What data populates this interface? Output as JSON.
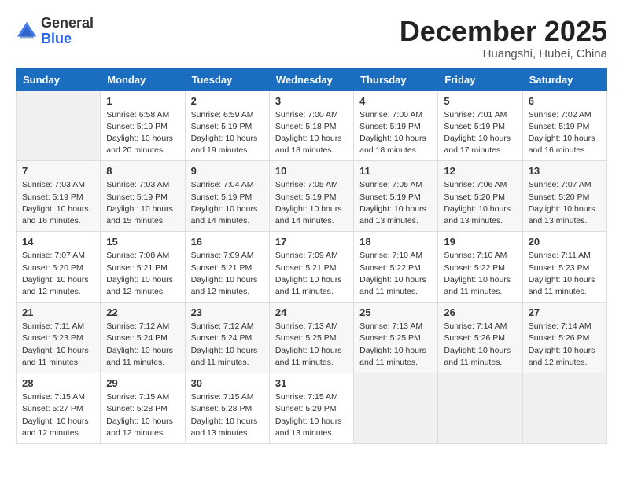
{
  "header": {
    "logo": {
      "line1": "General",
      "line2": "Blue"
    },
    "title": "December 2025",
    "subtitle": "Huangshi, Hubei, China"
  },
  "weekdays": [
    "Sunday",
    "Monday",
    "Tuesday",
    "Wednesday",
    "Thursday",
    "Friday",
    "Saturday"
  ],
  "weeks": [
    [
      {
        "day": "",
        "info": ""
      },
      {
        "day": "1",
        "info": "Sunrise: 6:58 AM\nSunset: 5:19 PM\nDaylight: 10 hours\nand 20 minutes."
      },
      {
        "day": "2",
        "info": "Sunrise: 6:59 AM\nSunset: 5:19 PM\nDaylight: 10 hours\nand 19 minutes."
      },
      {
        "day": "3",
        "info": "Sunrise: 7:00 AM\nSunset: 5:18 PM\nDaylight: 10 hours\nand 18 minutes."
      },
      {
        "day": "4",
        "info": "Sunrise: 7:00 AM\nSunset: 5:19 PM\nDaylight: 10 hours\nand 18 minutes."
      },
      {
        "day": "5",
        "info": "Sunrise: 7:01 AM\nSunset: 5:19 PM\nDaylight: 10 hours\nand 17 minutes."
      },
      {
        "day": "6",
        "info": "Sunrise: 7:02 AM\nSunset: 5:19 PM\nDaylight: 10 hours\nand 16 minutes."
      }
    ],
    [
      {
        "day": "7",
        "info": "Sunrise: 7:03 AM\nSunset: 5:19 PM\nDaylight: 10 hours\nand 16 minutes."
      },
      {
        "day": "8",
        "info": "Sunrise: 7:03 AM\nSunset: 5:19 PM\nDaylight: 10 hours\nand 15 minutes."
      },
      {
        "day": "9",
        "info": "Sunrise: 7:04 AM\nSunset: 5:19 PM\nDaylight: 10 hours\nand 14 minutes."
      },
      {
        "day": "10",
        "info": "Sunrise: 7:05 AM\nSunset: 5:19 PM\nDaylight: 10 hours\nand 14 minutes."
      },
      {
        "day": "11",
        "info": "Sunrise: 7:05 AM\nSunset: 5:19 PM\nDaylight: 10 hours\nand 13 minutes."
      },
      {
        "day": "12",
        "info": "Sunrise: 7:06 AM\nSunset: 5:20 PM\nDaylight: 10 hours\nand 13 minutes."
      },
      {
        "day": "13",
        "info": "Sunrise: 7:07 AM\nSunset: 5:20 PM\nDaylight: 10 hours\nand 13 minutes."
      }
    ],
    [
      {
        "day": "14",
        "info": "Sunrise: 7:07 AM\nSunset: 5:20 PM\nDaylight: 10 hours\nand 12 minutes."
      },
      {
        "day": "15",
        "info": "Sunrise: 7:08 AM\nSunset: 5:21 PM\nDaylight: 10 hours\nand 12 minutes."
      },
      {
        "day": "16",
        "info": "Sunrise: 7:09 AM\nSunset: 5:21 PM\nDaylight: 10 hours\nand 12 minutes."
      },
      {
        "day": "17",
        "info": "Sunrise: 7:09 AM\nSunset: 5:21 PM\nDaylight: 10 hours\nand 11 minutes."
      },
      {
        "day": "18",
        "info": "Sunrise: 7:10 AM\nSunset: 5:22 PM\nDaylight: 10 hours\nand 11 minutes."
      },
      {
        "day": "19",
        "info": "Sunrise: 7:10 AM\nSunset: 5:22 PM\nDaylight: 10 hours\nand 11 minutes."
      },
      {
        "day": "20",
        "info": "Sunrise: 7:11 AM\nSunset: 5:23 PM\nDaylight: 10 hours\nand 11 minutes."
      }
    ],
    [
      {
        "day": "21",
        "info": "Sunrise: 7:11 AM\nSunset: 5:23 PM\nDaylight: 10 hours\nand 11 minutes."
      },
      {
        "day": "22",
        "info": "Sunrise: 7:12 AM\nSunset: 5:24 PM\nDaylight: 10 hours\nand 11 minutes."
      },
      {
        "day": "23",
        "info": "Sunrise: 7:12 AM\nSunset: 5:24 PM\nDaylight: 10 hours\nand 11 minutes."
      },
      {
        "day": "24",
        "info": "Sunrise: 7:13 AM\nSunset: 5:25 PM\nDaylight: 10 hours\nand 11 minutes."
      },
      {
        "day": "25",
        "info": "Sunrise: 7:13 AM\nSunset: 5:25 PM\nDaylight: 10 hours\nand 11 minutes."
      },
      {
        "day": "26",
        "info": "Sunrise: 7:14 AM\nSunset: 5:26 PM\nDaylight: 10 hours\nand 11 minutes."
      },
      {
        "day": "27",
        "info": "Sunrise: 7:14 AM\nSunset: 5:26 PM\nDaylight: 10 hours\nand 12 minutes."
      }
    ],
    [
      {
        "day": "28",
        "info": "Sunrise: 7:15 AM\nSunset: 5:27 PM\nDaylight: 10 hours\nand 12 minutes."
      },
      {
        "day": "29",
        "info": "Sunrise: 7:15 AM\nSunset: 5:28 PM\nDaylight: 10 hours\nand 12 minutes."
      },
      {
        "day": "30",
        "info": "Sunrise: 7:15 AM\nSunset: 5:28 PM\nDaylight: 10 hours\nand 13 minutes."
      },
      {
        "day": "31",
        "info": "Sunrise: 7:15 AM\nSunset: 5:29 PM\nDaylight: 10 hours\nand 13 minutes."
      },
      {
        "day": "",
        "info": ""
      },
      {
        "day": "",
        "info": ""
      },
      {
        "day": "",
        "info": ""
      }
    ]
  ]
}
